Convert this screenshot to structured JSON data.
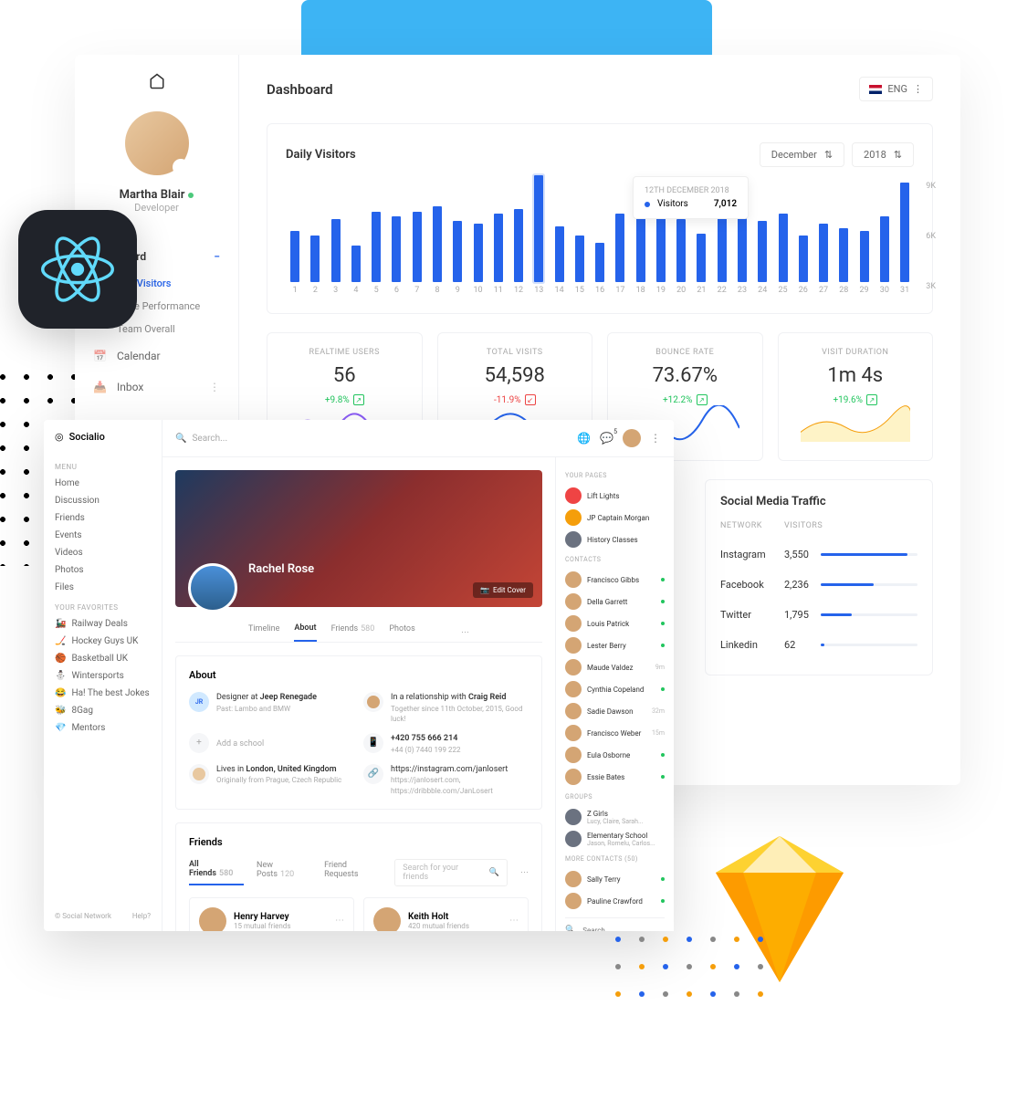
{
  "dashboard": {
    "title": "Dashboard",
    "language": "ENG",
    "profile": {
      "name": "Martha Blair",
      "role": "Developer"
    },
    "nav": {
      "dashboard": "Dashboard",
      "site_visitors": "Site Visitors",
      "page_performance": "Page Performance",
      "team_overall": "Team Overall",
      "calendar": "Calendar",
      "inbox": "Inbox"
    },
    "chart_title": "Daily Visitors",
    "month_sel": "December",
    "year_sel": "2018",
    "tooltip": {
      "date": "12TH DECEMBER 2018",
      "label": "Visitors",
      "value": "7,012"
    },
    "stats": [
      {
        "label": "REALTIME USERS",
        "value": "56",
        "change": "+9.8%",
        "dir": "up"
      },
      {
        "label": "TOTAL VISITS",
        "value": "54,598",
        "change": "-11.9%",
        "dir": "down"
      },
      {
        "label": "BOUNCE RATE",
        "value": "73.67%",
        "change": "+12.2%",
        "dir": "up"
      },
      {
        "label": "VISIT DURATION",
        "value": "1m 4s",
        "change": "+19.6%",
        "dir": "up"
      }
    ],
    "social_traffic": {
      "title": "Social Media Traffic",
      "h1": "NETWORK",
      "h2": "VISITORS",
      "rows": [
        {
          "net": "Instagram",
          "vis": "3,550",
          "pct": 90
        },
        {
          "net": "Facebook",
          "vis": "2,236",
          "pct": 55
        },
        {
          "net": "Twitter",
          "vis": "1,795",
          "pct": 32
        },
        {
          "net": "Linkedin",
          "vis": "62",
          "pct": 4
        }
      ]
    }
  },
  "chart_data": {
    "type": "bar",
    "categories": [
      1,
      2,
      3,
      4,
      5,
      6,
      7,
      8,
      9,
      10,
      11,
      12,
      13,
      14,
      15,
      16,
      17,
      18,
      19,
      20,
      21,
      22,
      23,
      24,
      25,
      26,
      27,
      28,
      29,
      30,
      31
    ],
    "values": [
      4200,
      3800,
      5200,
      3000,
      5800,
      5400,
      5800,
      6200,
      5000,
      4800,
      5600,
      6000,
      8800,
      4600,
      3800,
      3200,
      5600,
      7400,
      5800,
      5200,
      4000,
      6400,
      5400,
      5000,
      5600,
      3800,
      4800,
      4400,
      4200,
      5400,
      8200
    ],
    "y_ticks": [
      "9K",
      "6K",
      "3K"
    ],
    "ylim": [
      0,
      9000
    ],
    "xlabel": "Day",
    "ylabel": "Visitors",
    "highlight_index": 12
  },
  "socialio": {
    "brand": "Socialio",
    "search_ph": "Search...",
    "notif_count": "5",
    "menu_h": "MENU",
    "menu": [
      "Home",
      "Discussion",
      "Friends",
      "Events",
      "Videos",
      "Photos",
      "Files"
    ],
    "fav_h": "YOUR FAVORITES",
    "favorites": [
      {
        "emoji": "🚂",
        "label": "Railway Deals"
      },
      {
        "emoji": "🏒",
        "label": "Hockey Guys UK"
      },
      {
        "emoji": "🏀",
        "label": "Basketball UK"
      },
      {
        "emoji": "⛄",
        "label": "Wintersports"
      },
      {
        "emoji": "😂",
        "label": "Ha! The best Jokes"
      },
      {
        "emoji": "🐝",
        "label": "8Gag"
      },
      {
        "emoji": "💎",
        "label": "Mentors"
      }
    ],
    "footer_l": "© Social Network",
    "footer_r": "Help?",
    "profile": {
      "name": "Rachel Rose",
      "edit_cover": "Edit Cover",
      "tabs": {
        "timeline": "Timeline",
        "about": "About",
        "friends": "Friends",
        "friends_cnt": "580",
        "photos": "Photos"
      }
    },
    "about": {
      "title": "About",
      "work1": "Designer at ",
      "work1b": "Jeep Renegade",
      "work1s": "Past: Lambo and BMW",
      "rel": "In a relationship with ",
      "relb": "Craig Reid",
      "rels": "Together since 11th October, 2015, Good luck!",
      "add_school": "Add a school",
      "phone1": "+420 755 666 214",
      "phone2": "+44 (0) 7440 199 222",
      "loc": "Lives in ",
      "locb": "London, United Kingdom",
      "locs": "Originally from Prague, Czech Republic",
      "link1": "https://instagram.com/janlosert",
      "link2": "https://janlosert.com, https://dribbble.com/JanLosert"
    },
    "friends": {
      "title": "Friends",
      "t1": "All Friends",
      "t1c": "580",
      "t2": "New Posts",
      "t2c": "120",
      "t3": "Friend Requests",
      "search_ph": "Search for your friends",
      "list": [
        {
          "name": "Henry Harvey",
          "sub": "15 mutual friends"
        },
        {
          "name": "Keith Holt",
          "sub": "420 mutual friends"
        }
      ]
    },
    "sidebar": {
      "pages_h": "YOUR PAGES",
      "pages": [
        "Lift Lights",
        "JP Captain Morgan",
        "History Classes"
      ],
      "contacts_h": "CONTACTS",
      "contacts": [
        {
          "name": "Francisco Gibbs",
          "status": "on"
        },
        {
          "name": "Della Garrett",
          "status": "on"
        },
        {
          "name": "Louis Patrick",
          "status": "on"
        },
        {
          "name": "Lester Berry",
          "status": "on"
        },
        {
          "name": "Maude Valdez",
          "status": "9m"
        },
        {
          "name": "Cynthia Copeland",
          "status": "on"
        },
        {
          "name": "Sadie Dawson",
          "status": "32m"
        },
        {
          "name": "Francisco Weber",
          "status": "15m"
        },
        {
          "name": "Eula Osborne",
          "status": "on"
        },
        {
          "name": "Essie Bates",
          "status": "on"
        }
      ],
      "groups_h": "GROUPS",
      "groups": [
        {
          "name": "Z Girls",
          "sub": "Lucy, Claire, Sarah..."
        },
        {
          "name": "Elementary School",
          "sub": "Jason, Romelu, Carlos..."
        }
      ],
      "more_h": "MORE CONTACTS (50)",
      "more": [
        {
          "name": "Sally Terry",
          "status": "on"
        },
        {
          "name": "Pauline Crawford",
          "status": "on"
        }
      ],
      "search_ph": "Search..."
    }
  }
}
